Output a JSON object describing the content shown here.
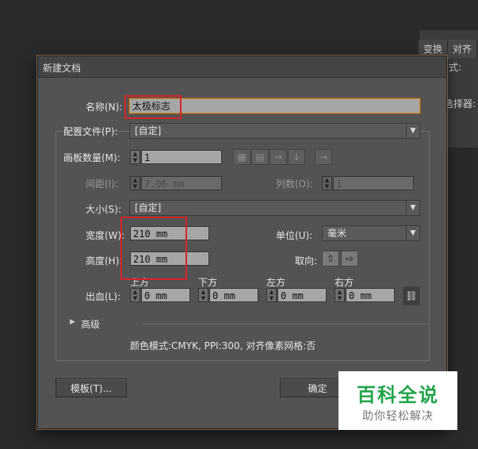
{
  "background_panel": {
    "tabs": [
      "变换",
      "对齐"
    ],
    "label_mode": "式:",
    "label_picker": "选择器:"
  },
  "dialog": {
    "title": "新建文档",
    "name_label": "名称(N):",
    "name_value": "太极标志",
    "profile_label": "配置文件(P):",
    "profile_value": "[自定]",
    "artboard_count_label": "画板数量(M):",
    "artboard_count_value": "1",
    "spacing_label": "间距(I):",
    "spacing_value": "7.06 mm",
    "columns_label": "列数(O):",
    "columns_value": "1",
    "size_label": "大小(S):",
    "size_value": "[自定]",
    "width_label": "宽度(W):",
    "width_value": "210 mm",
    "units_label": "单位(U):",
    "units_value": "毫米",
    "height_label": "高度(H):",
    "height_value": "210 mm",
    "orientation_label": "取向:",
    "bleed_label": "出血(L):",
    "bleed": [
      {
        "label": "上方",
        "value": "0 mm"
      },
      {
        "label": "下方",
        "value": "0 mm"
      },
      {
        "label": "左方",
        "value": "0 mm"
      },
      {
        "label": "右方",
        "value": "0 mm"
      }
    ],
    "advanced_label": "高级",
    "summary": "颜色模式:CMYK, PPI:300, 对齐像素网格:否",
    "template_button": "模板(T)...",
    "ok_button": "确定"
  },
  "watermark": {
    "title": "百科全说",
    "subtitle": "助你轻松解决"
  },
  "colors": {
    "dialog_bg": "#535353",
    "highlight_box": "#d9232a",
    "watermark_green": "#22a34a"
  }
}
